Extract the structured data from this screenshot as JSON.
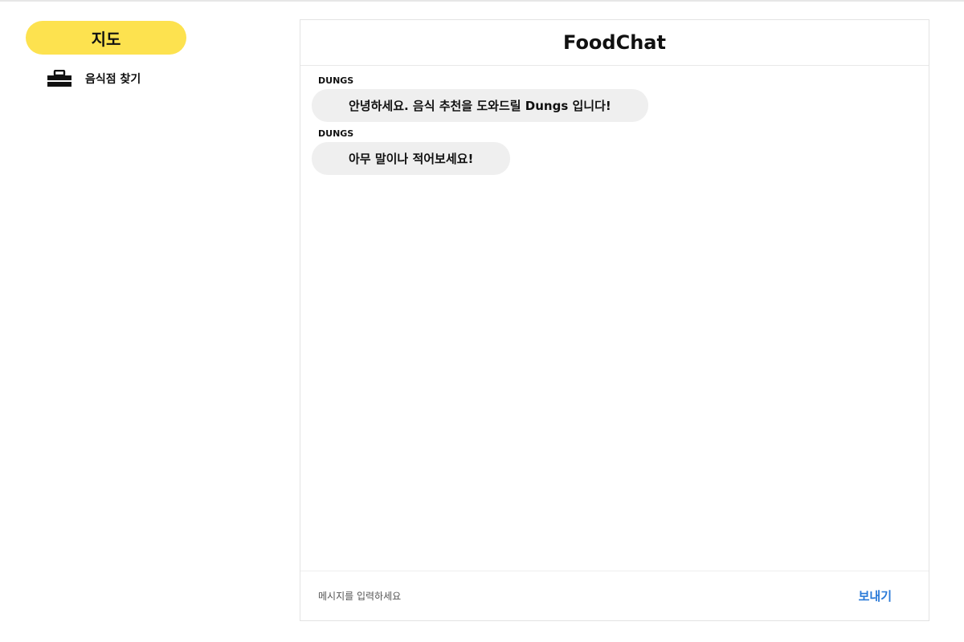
{
  "sidebar": {
    "map_button": "지도",
    "items": [
      {
        "label": "음식점 찾기",
        "icon": "briefcase-icon"
      }
    ]
  },
  "chat": {
    "title": "FoodChat",
    "messages": [
      {
        "sender": "DUNGS",
        "text": "안녕하세요. 음식 추천을 도와드릴 Dungs 입니다!"
      },
      {
        "sender": "DUNGS",
        "text": "아무 말이나 적어보세요!"
      }
    ],
    "input": {
      "value": "",
      "placeholder": "메시지를 입력하세요"
    },
    "send_label": "보내기"
  },
  "colors": {
    "accent_yellow": "#fde24f",
    "send_blue": "#2a7ad8",
    "bubble_gray": "#efefef"
  }
}
